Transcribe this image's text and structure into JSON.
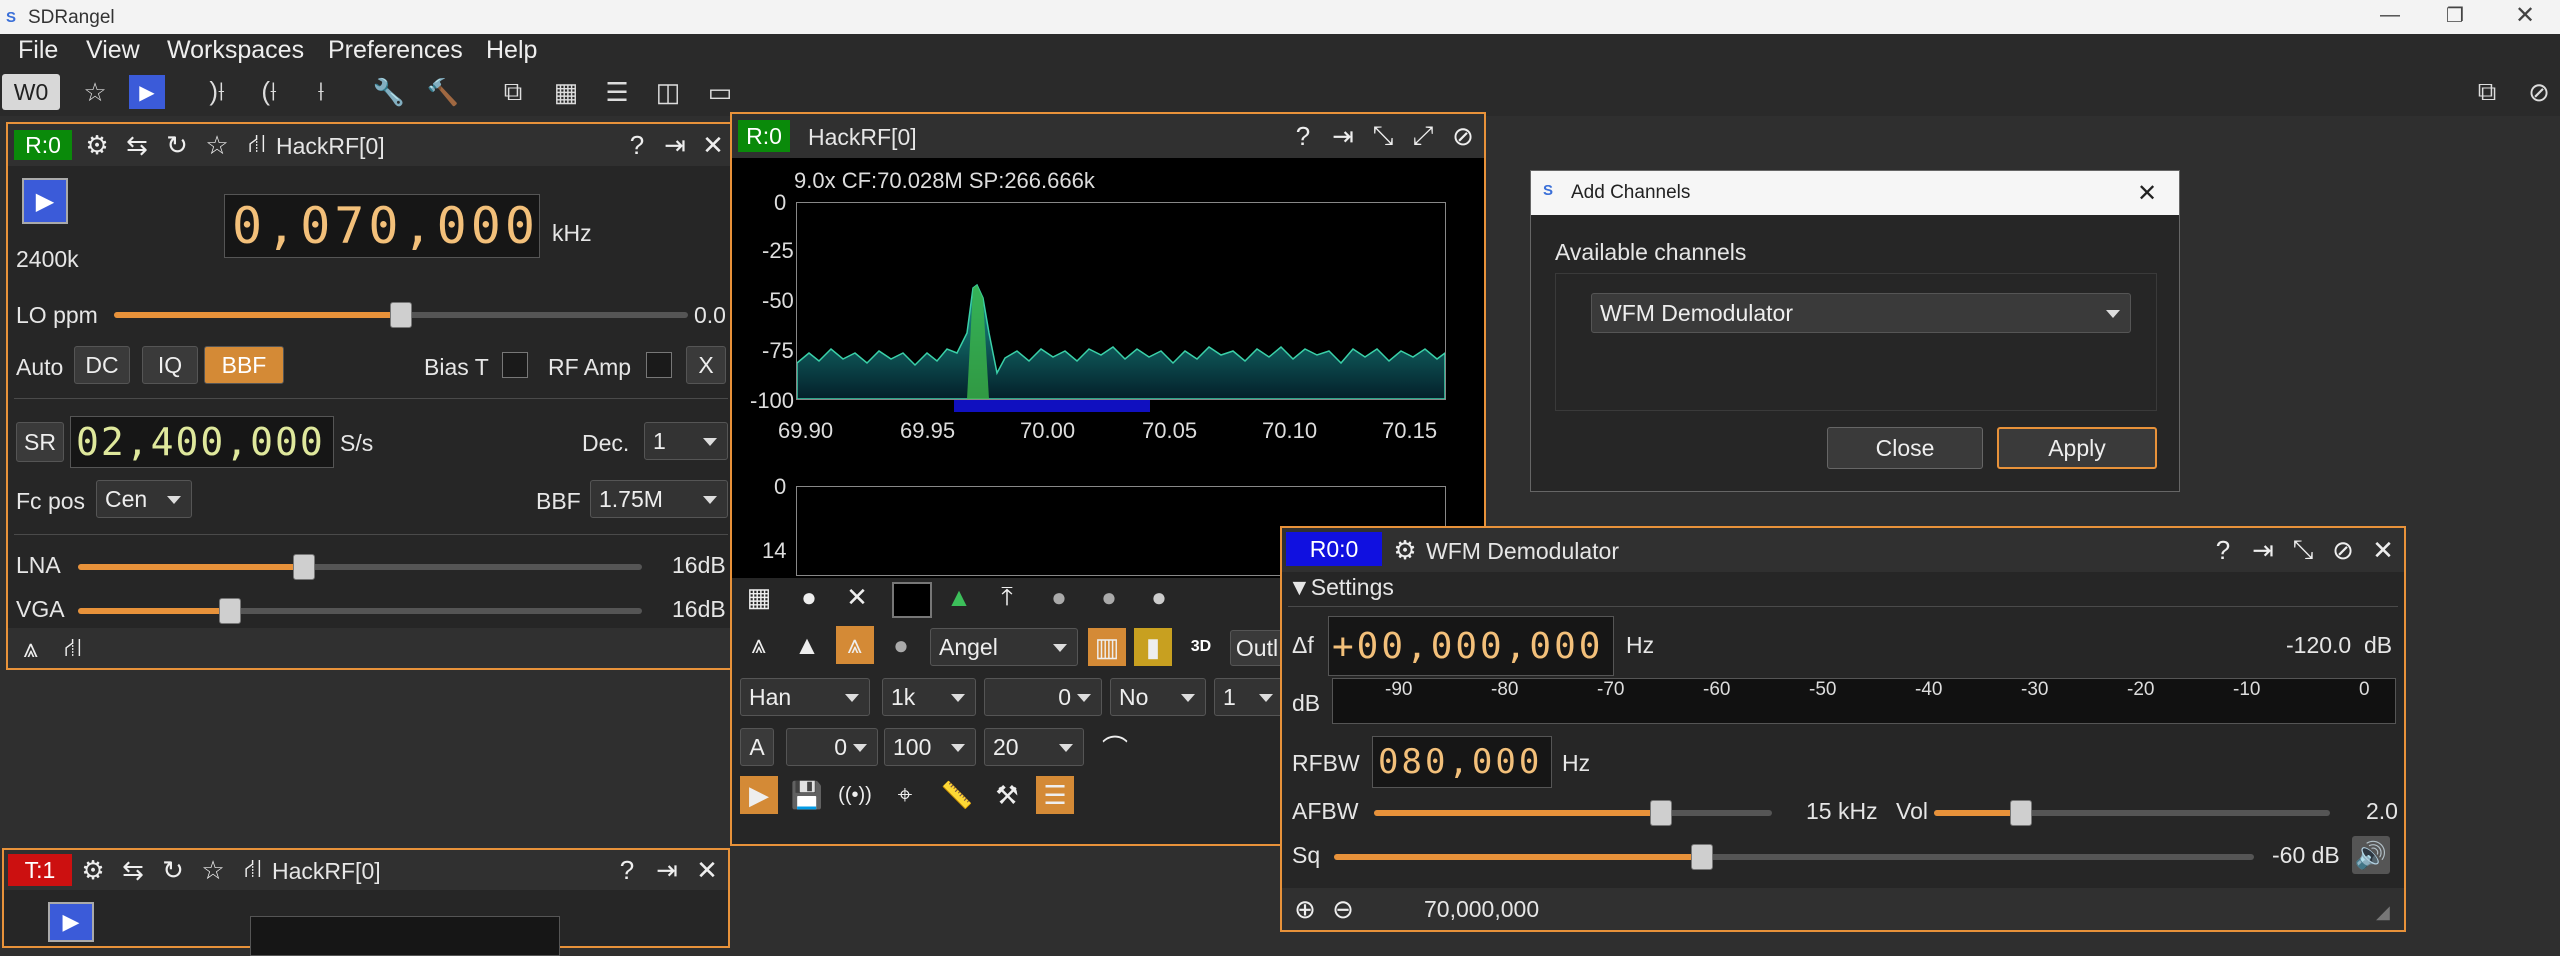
{
  "app": {
    "title": "SDRangel"
  },
  "menu": {
    "file": "File",
    "view": "View",
    "workspaces": "Workspaces",
    "preferences": "Preferences",
    "help": "Help"
  },
  "toolbar": {
    "workspace": "W0"
  },
  "rx": {
    "tag": "R:0",
    "title": "HackRF[0]",
    "bandwidth": "2400k",
    "freq": "0,070,000",
    "freq_unit": "kHz",
    "lo_label": "LO ppm",
    "lo_value": "0.0",
    "lo_level": 0.5,
    "auto": "Auto",
    "dc": "DC",
    "iq": "IQ",
    "bbf": "BBF",
    "bias": "Bias T",
    "rfamp": "RF Amp",
    "x": "X",
    "sr_btn": "SR",
    "sr_value": "02,400,000",
    "sr_unit": "S/s",
    "dec_label": "Dec.",
    "dec_value": "1",
    "fcpos_label": "Fc pos",
    "fcpos_value": "Cen",
    "bbf_label": "BBF",
    "bbf_value": "1.75M",
    "lna_label": "LNA",
    "lna_value": "16dB",
    "lna_level": 0.4,
    "vga_label": "VGA",
    "vga_value": "16dB",
    "vga_level": 0.27
  },
  "spectrum": {
    "tag": "R:0",
    "title": "HackRF[0]",
    "info": "9.0x CF:70.028M SP:266.666k",
    "y_ticks": [
      "0",
      "-25",
      "-50",
      "-75",
      "-100"
    ],
    "x_ticks": [
      "69.90",
      "69.95",
      "70.00",
      "70.05",
      "70.10",
      "70.15"
    ],
    "wf_ticks": [
      "0",
      "14"
    ],
    "palette": "Angel",
    "window": "Han",
    "fft_size": "1k",
    "offset": "0",
    "avg_mode": "No",
    "avg_value": "1",
    "a_btn": "A",
    "ref": "0",
    "range": "100",
    "rate": "20",
    "outline": "Outl"
  },
  "dialog": {
    "title": "Add Channels",
    "label": "Available channels",
    "selected": "WFM Demodulator",
    "close": "Close",
    "apply": "Apply"
  },
  "wfm": {
    "tag": "R0:0",
    "title": "WFM Demodulator",
    "settings": "Settings",
    "df_label": "Δf",
    "df_value": "+00,000,000",
    "df_unit": "Hz",
    "power": "-120.0  dB",
    "db_label": "dB",
    "scale": [
      "-90",
      "-80",
      "-70",
      "-60",
      "-50",
      "-40",
      "-30",
      "-20",
      "-10",
      "0"
    ],
    "rfbw_label": "RFBW",
    "rfbw_value": "080,000",
    "rfbw_unit": "Hz",
    "afbw_label": "AFBW",
    "afbw_value": "15 kHz",
    "afbw_level": 0.72,
    "vol_label": "Vol",
    "vol_value": "2.0",
    "vol_level": 0.22,
    "sq_label": "Sq",
    "sq_value": "-60 dB",
    "sq_level": 0.4,
    "frequency": "70,000,000"
  },
  "tx": {
    "tag": "T:1",
    "title": "HackRF[0]"
  },
  "colors": {
    "accent": "#e8923a",
    "rx_tag": "#0a8a0a",
    "tx_tag": "#cc1010",
    "ch_tag": "#1010e0"
  }
}
